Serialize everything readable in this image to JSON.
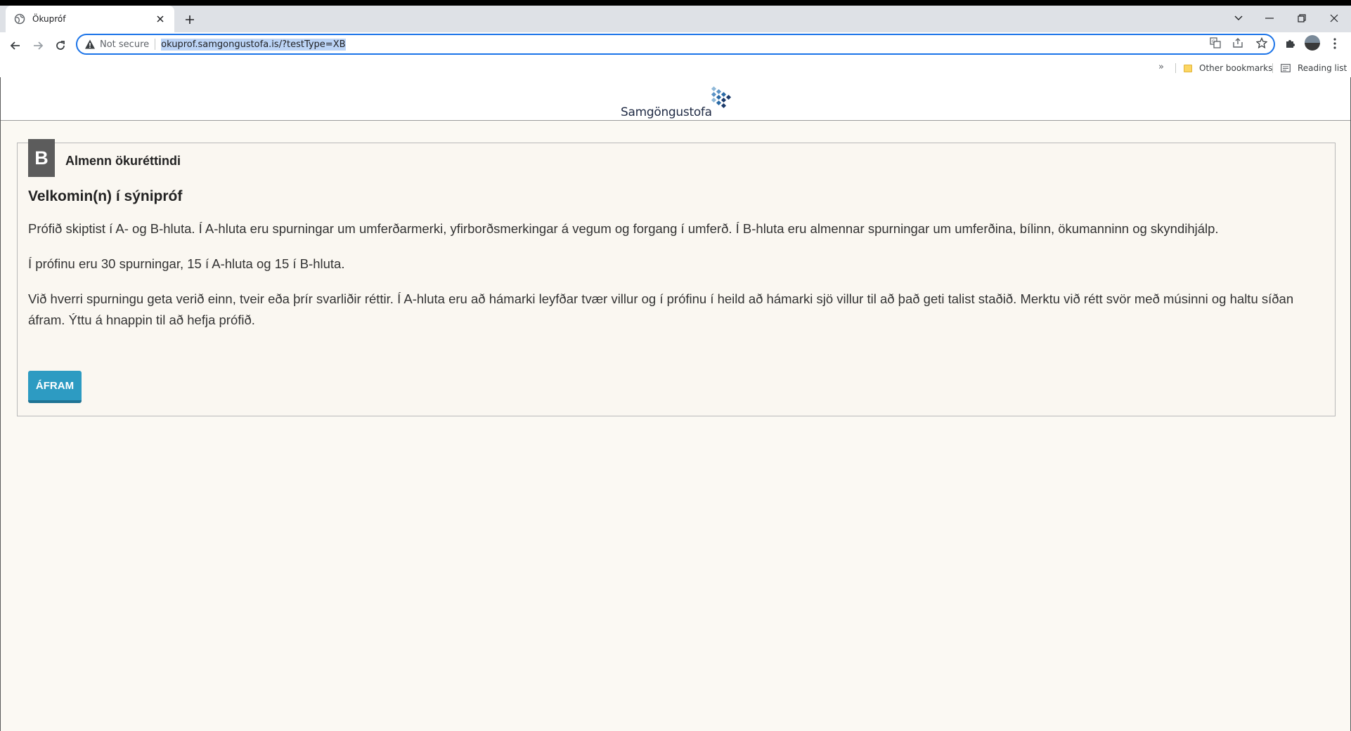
{
  "browser": {
    "tab_title": "Ökupróf",
    "security_label": "Not secure",
    "url": "okuprof.samgongustofa.is/?testType=XB",
    "bookmarks": {
      "overflow_label": "»",
      "other_bookmarks": "Other bookmarks",
      "reading_list": "Reading list"
    }
  },
  "site": {
    "logo_text": "Samgöngustofa"
  },
  "card": {
    "badge": "B",
    "category_title": "Almenn ökuréttindi",
    "welcome_title": "Velkomin(n) í sýnipróf",
    "paragraphs": [
      "Prófið skiptist í A- og B-hluta. Í A-hluta eru spurningar um umferðarmerki, yfirborðsmerkingar á vegum og forgang í umferð. Í B-hluta eru almennar spurningar um umferðina, bílinn, ökumanninn og skyndihjálp.",
      "Í prófinu eru 30 spurningar, 15 í A-hluta og 15 í B-hluta.",
      "Við hverri spurningu geta verið einn, tveir eða þrír svarliðir réttir. Í A-hluta eru að hámarki leyfðar tvær villur og í prófinu í heild að hámarki sjö villur til að það geti talist staðið. Merktu við rétt svör með músinni og haltu síðan áfram. Ýttu á hnappin til að hefja prófið."
    ],
    "continue_button": "ÁFRAM"
  },
  "colors": {
    "button": "#2d9bc2",
    "badge": "#5c5c5c",
    "page_background": "#fbf9f3",
    "url_highlight": "#bcd4f6"
  }
}
